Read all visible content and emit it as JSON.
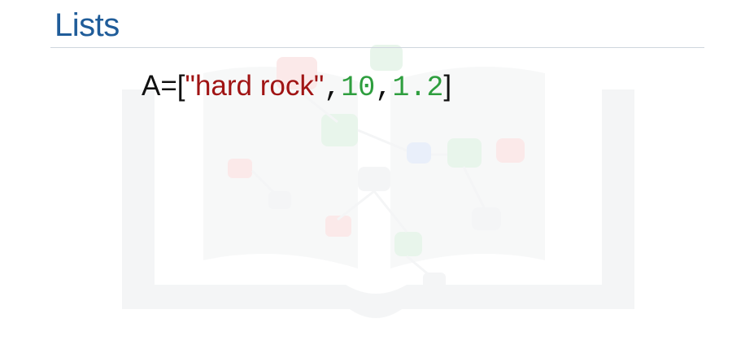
{
  "slide": {
    "title": "Lists",
    "code": {
      "var_assign": "A=[",
      "string_literal": "\"hard rock\"",
      "comma_1": ",",
      "number_1": "10",
      "comma_2": ",",
      "number_2": "1.2",
      "close_bracket": "]"
    }
  },
  "colors": {
    "title": "#1f5c99",
    "string": "#a01414",
    "number": "#2e9e3e",
    "text": "#111111"
  },
  "watermark": {
    "icon": "open-book-network-icon"
  }
}
